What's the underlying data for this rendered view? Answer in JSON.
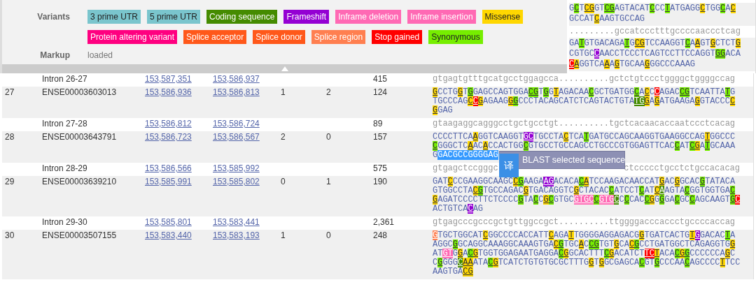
{
  "legend": {
    "variants_label": "Variants",
    "markup_label": "Markup",
    "markup_value": "loaded",
    "variants": [
      {
        "label": "3 prime UTR",
        "kind": "three_prime_utr",
        "color": "#7ac5cd"
      },
      {
        "label": "5 prime UTR",
        "kind": "five_prime_utr",
        "color": "#7ac5cd"
      },
      {
        "label": "Coding sequence",
        "kind": "coding_sequence",
        "color": "#458b00"
      },
      {
        "label": "Frameshift",
        "kind": "frameshift",
        "color": "#9400d3"
      },
      {
        "label": "Inframe deletion",
        "kind": "inframe_deletion",
        "color": "#ff69b4"
      },
      {
        "label": "Inframe insertion",
        "kind": "inframe_insertion",
        "color": "#ff69b4"
      },
      {
        "label": "Missense",
        "kind": "missense",
        "color": "#ffd700"
      },
      {
        "label": "Protein altering variant",
        "kind": "protein_altering",
        "color": "#ff0080"
      },
      {
        "label": "Splice acceptor",
        "kind": "splice_acceptor",
        "color": "#ff581a"
      },
      {
        "label": "Splice donor",
        "kind": "splice_donor",
        "color": "#ff581a"
      },
      {
        "label": "Splice region",
        "kind": "splice_region",
        "color": "#ff7f50"
      },
      {
        "label": "Stop gained",
        "kind": "stop_gained",
        "color": "#ff0000"
      },
      {
        "label": "Synonymous",
        "kind": "synonymous",
        "color": "#76ee00"
      }
    ]
  },
  "upper_rows": [
    {
      "kind": "exon",
      "lines": [
        [
          {
            "text": "G"
          },
          {
            "text": "C",
            "kind": "synonymous"
          },
          {
            "text": "T"
          },
          {
            "text": "CG",
            "kind": "missense"
          },
          {
            "text": "GT"
          },
          {
            "text": "CG",
            "kind": "synonymous"
          },
          {
            "text": "AGTACAT"
          },
          {
            "text": "C",
            "kind": "synonymous"
          },
          {
            "text": "CC"
          },
          {
            "text": "T",
            "kind": "synonymous"
          },
          {
            "text": "ATGAGG"
          },
          {
            "text": "C",
            "kind": "missense"
          },
          {
            "text": "TGG"
          },
          {
            "text": "C",
            "kind": "synonymous"
          },
          {
            "text": "A"
          },
          {
            "text": "C",
            "kind": "missense"
          }
        ],
        [
          {
            "text": "GCCAT"
          },
          {
            "text": "C",
            "kind": "missense"
          },
          {
            "text": "AAGTGCCAG"
          }
        ]
      ]
    },
    {
      "kind": "intron",
      "sequence_parts": [
        ".........gccatccctttgccccaaccctcag"
      ]
    },
    {
      "kind": "exon",
      "lines": [
        [
          {
            "text": "GA"
          },
          {
            "text": "T",
            "kind": "synonymous"
          },
          {
            "text": "GTGACAGA"
          },
          {
            "text": "T",
            "kind": "synonymous"
          },
          {
            "text": "G"
          },
          {
            "text": "CG",
            "kind": "missense"
          },
          {
            "text": "TCCAAGGT"
          },
          {
            "text": "C",
            "kind": "synonymous"
          },
          {
            "text": "A"
          },
          {
            "text": "A",
            "kind": "missense"
          },
          {
            "text": "GT"
          },
          {
            "text": "G",
            "kind": "missense"
          },
          {
            "text": "CTCT"
          },
          {
            "text": "G",
            "kind": "missense"
          }
        ],
        [
          {
            "text": "CGTGC"
          },
          {
            "text": "C",
            "kind": "frameshift"
          },
          {
            "text": "AACCTCCCTCAGTCCTTCCAGGT"
          },
          {
            "text": "GG",
            "kind": "synonymous"
          },
          {
            "text": "ACA"
          }
        ],
        [
          {
            "text": "C",
            "kind": "stop_gained"
          },
          {
            "text": "A",
            "kind": "missense"
          },
          {
            "text": "GGTCA"
          },
          {
            "text": "A",
            "kind": "missense"
          },
          {
            "text": "A"
          },
          {
            "text": "G",
            "kind": "missense"
          },
          {
            "text": "TGCAA"
          },
          {
            "text": "G",
            "kind": "missense"
          },
          {
            "text": "GGCCCAAAG"
          }
        ]
      ]
    }
  ],
  "rows": [
    {
      "kind": "intron",
      "name": "Intron 26-27",
      "start": "153,587,351",
      "end": "153,586,937",
      "length": "415",
      "sequence_parts": [
        "gtgagtgtttgcatgcctggagcca..........gctctgtccctggggctggggccag"
      ]
    },
    {
      "kind": "exon",
      "no": "27",
      "name": "ENSE00003603013",
      "start": "153,586,936",
      "end": "153,586,813",
      "start_phase": "1",
      "end_phase": "2",
      "length": "124",
      "lines": [
        [
          {
            "text": "G",
            "kind": "missense"
          },
          {
            "text": "CCTG"
          },
          {
            "text": "G",
            "kind": "missense"
          },
          {
            "text": "T"
          },
          {
            "text": "G",
            "kind": "synonymous"
          },
          {
            "text": "GAGCCAGTGGA"
          },
          {
            "text": "CG",
            "kind": "synonymous"
          },
          {
            "text": "T"
          },
          {
            "text": "G",
            "kind": "synonymous"
          },
          {
            "text": "G"
          },
          {
            "text": "T",
            "kind": "missense"
          },
          {
            "text": "AGACAA"
          },
          {
            "text": "C",
            "kind": "synonymous"
          },
          {
            "text": "GCTGATGG"
          },
          {
            "text": "C",
            "kind": "synonymous"
          },
          {
            "text": "A"
          },
          {
            "text": "C",
            "kind": "missense"
          },
          {
            "text": "C"
          },
          {
            "text": "C",
            "kind": "stop_gained"
          },
          {
            "text": "AGAC"
          },
          {
            "text": "CG",
            "kind": "synonymous"
          },
          {
            "text": "TCAATTA"
          },
          {
            "text": "T",
            "kind": "synonymous"
          },
          {
            "text": "G"
          }
        ],
        [
          {
            "text": "TGCCCAG"
          },
          {
            "text": "C",
            "kind": "missense"
          },
          {
            "text": "C",
            "kind": "stop_gained"
          },
          {
            "text": "G",
            "kind": "missense"
          },
          {
            "text": "AGAAG"
          },
          {
            "text": "G",
            "kind": "missense"
          },
          {
            "text": "G",
            "kind": "synonymous"
          },
          {
            "text": "CCCTACAGCATCTCAGTACTGTA"
          },
          {
            "text": "TG",
            "kind": "coding_sequence"
          },
          {
            "text": "G",
            "kind": "missense"
          },
          {
            "text": "A"
          },
          {
            "text": "G",
            "kind": "missense"
          },
          {
            "text": "ATGAAGA"
          },
          {
            "text": "G",
            "kind": "missense"
          },
          {
            "text": "GTACCC"
          },
          {
            "text": "C",
            "kind": "missense"
          }
        ],
        [
          {
            "text": "G",
            "kind": "missense"
          },
          {
            "text": "GAG"
          }
        ]
      ]
    },
    {
      "kind": "intron",
      "name": "Intron 27-28",
      "start": "153,586,812",
      "end": "153,586,724",
      "length": "89",
      "sequence_parts": [
        "gtaagaggcagggcctgctgcctgt..........tgctcacaacaccaatccctcacag"
      ]
    },
    {
      "kind": "exon",
      "no": "28",
      "name": "ENSE00003643791",
      "start": "153,586,723",
      "end": "153,586,567",
      "start_phase": "2",
      "end_phase": "0",
      "length": "157",
      "blast_tooltip": {
        "label": "BLAST selected sequence",
        "translate": "译"
      },
      "lines": [
        [
          {
            "text": "CCCCTTCA"
          },
          {
            "text": "A",
            "kind": "missense"
          },
          {
            "text": "GGTCAAGGT"
          },
          {
            "text": "GC",
            "kind": "frameshift"
          },
          {
            "text": "TGCCTA"
          },
          {
            "text": "C",
            "kind": "missense"
          },
          {
            "text": "TCA"
          },
          {
            "text": "T",
            "kind": "synonymous"
          },
          {
            "text": "GATGCCAGCAAGGTGAAGGCCAG"
          },
          {
            "text": "T",
            "kind": "missense"
          },
          {
            "text": "GGCCC"
          }
        ],
        [
          {
            "text": "C",
            "kind": "synonymous"
          },
          {
            "text": "GGGCTC"
          },
          {
            "text": "A",
            "kind": "missense"
          },
          {
            "text": "AC"
          },
          {
            "text": "A",
            "kind": "missense"
          },
          {
            "text": "CCACTGG"
          },
          {
            "text": "C",
            "kind": "synonymous"
          },
          {
            "text": "GTGCCTGCCAGCCTGCCCGTGGAGTTCAC"
          },
          {
            "text": "C",
            "kind": "synonymous"
          },
          {
            "text": "AT"
          },
          {
            "text": "C",
            "kind": "synonymous"
          },
          {
            "text": "G",
            "kind": "missense"
          },
          {
            "text": "A"
          },
          {
            "text": "T",
            "kind": "synonymous"
          },
          {
            "text": "GCAAA"
          }
        ],
        [
          {
            "text": "G",
            "selected": false
          },
          {
            "text": "GACGCCGGGGAG",
            "selected": true
          }
        ]
      ]
    },
    {
      "kind": "intron",
      "name": "Intron 28-29",
      "start": "153,586,566",
      "end": "153,585,992",
      "length": "575",
      "sequence_parts": [
        "gtgagctccgggc",
        "ctccccctgcctctgccacacag"
      ]
    },
    {
      "kind": "exon",
      "no": "29",
      "name": "ENSE00003639210",
      "start": "153,585,991",
      "end": "153,585,802",
      "start_phase": "0",
      "end_phase": "1",
      "length": "190",
      "lines": [
        [
          {
            "text": "GAT"
          },
          {
            "text": "C",
            "kind": "missense"
          },
          {
            "text": "CCGAAGGCAAGC"
          },
          {
            "text": "C",
            "kind": "missense"
          },
          {
            "text": "G",
            "kind": "synonymous"
          },
          {
            "text": "AAGA"
          },
          {
            "text": "AG",
            "kind": "frameshift"
          },
          {
            "text": "ACACA"
          },
          {
            "text": "C",
            "kind": "synonymous"
          },
          {
            "text": "A",
            "kind": "missense"
          },
          {
            "text": "TCCAAGACAACCAT"
          },
          {
            "text": "G",
            "kind": "missense"
          },
          {
            "text": "AC"
          },
          {
            "text": "G",
            "kind": "missense"
          },
          {
            "text": "GCAC"
          },
          {
            "text": "G",
            "kind": "synonymous"
          },
          {
            "text": "TATACA"
          }
        ],
        [
          {
            "text": "GTGGCCTA"
          },
          {
            "text": "C",
            "kind": "missense"
          },
          {
            "text": "G",
            "kind": "synonymous"
          },
          {
            "text": "TGCCAGAC"
          },
          {
            "text": "G",
            "kind": "missense"
          },
          {
            "text": "TGACAGGTC"
          },
          {
            "text": "G",
            "kind": "missense"
          },
          {
            "text": "CTACAC"
          },
          {
            "text": "C",
            "kind": "synonymous"
          },
          {
            "text": "ATCCT"
          },
          {
            "text": "C",
            "kind": "synonymous"
          },
          {
            "text": "AT"
          },
          {
            "text": "C",
            "kind": "missense"
          },
          {
            "text": "A",
            "kind": "coding_sequence"
          },
          {
            "text": "AGTA"
          },
          {
            "text": "C",
            "kind": "synonymous"
          },
          {
            "text": "GGTGGTGA"
          },
          {
            "text": "C",
            "kind": "synonymous"
          }
        ],
        [
          {
            "text": "G",
            "kind": "missense"
          },
          {
            "text": "AGATCCCCTTCTCCCC"
          },
          {
            "text": "G",
            "kind": "synonymous"
          },
          {
            "text": "TA"
          },
          {
            "text": "C",
            "kind": "synonymous"
          },
          {
            "text": "C"
          },
          {
            "text": "G",
            "kind": "missense"
          },
          {
            "text": "C",
            "kind": "synonymous"
          },
          {
            "text": "GTGC"
          },
          {
            "text": "GTGC",
            "kind": "inframe_deletion"
          },
          {
            "text": "C",
            "kind": "synonymous"
          },
          {
            "text": "GTG",
            "kind": "inframe_deletion"
          },
          {
            "text": "C",
            "kind": "coding_sequence"
          },
          {
            "text": "C"
          },
          {
            "text": "C",
            "kind": "synonymous"
          },
          {
            "text": "CAC"
          },
          {
            "text": "C",
            "kind": "synonymous"
          },
          {
            "text": "G",
            "kind": "missense"
          },
          {
            "text": "G"
          },
          {
            "text": "G",
            "kind": "synonymous"
          },
          {
            "text": "GA"
          },
          {
            "text": "C",
            "kind": "synonymous"
          },
          {
            "text": "GC"
          },
          {
            "text": "C",
            "kind": "synonymous"
          },
          {
            "text": "AGCAAGT"
          },
          {
            "text": "G",
            "kind": "synonymous"
          },
          {
            "text": "C",
            "kind": "stop_gained"
          }
        ],
        [
          {
            "text": "ACTGTCA"
          },
          {
            "text": "C",
            "kind": "frameshift"
          },
          {
            "text": "AG"
          }
        ]
      ]
    },
    {
      "kind": "intron",
      "name": "Intron 29-30",
      "start": "153,585,801",
      "end": "153,583,441",
      "length": "2,361",
      "sequence_parts": [
        "gtgagcccgcccgctgttggccgct..........ttggggacccaccctgccccaccag"
      ]
    },
    {
      "kind": "exon",
      "no": "30",
      "name": "ENSE00003507155",
      "start": "153,583,440",
      "end": "153,583,193",
      "start_phase": "1",
      "end_phase": "0",
      "length": "248",
      "lines": [
        [
          {
            "text": "G",
            "kind": "splice_region"
          },
          {
            "text": "TGCTGGCAT"
          },
          {
            "text": "C",
            "kind": "missense"
          },
          {
            "text": "GGCCCCACCATT"
          },
          {
            "text": "C",
            "kind": "missense"
          },
          {
            "text": "AGA"
          },
          {
            "text": "T",
            "kind": "missense"
          },
          {
            "text": "TGGGGAGGAGACG"
          },
          {
            "text": "G",
            "kind": "missense"
          },
          {
            "text": "TGATCACTG"
          },
          {
            "text": "T",
            "kind": "missense"
          },
          {
            "text": "G",
            "kind": "frameshift"
          },
          {
            "text": "GACAC"
          },
          {
            "text": "T",
            "kind": "synonymous"
          },
          {
            "text": "A"
          }
        ],
        [
          {
            "text": "AGGC"
          },
          {
            "text": "G",
            "kind": "synonymous"
          },
          {
            "text": "GCAGGCAAAGGCAAAGTGA"
          },
          {
            "text": "C",
            "kind": "missense"
          },
          {
            "text": "G",
            "kind": "synonymous"
          },
          {
            "text": "TGC"
          },
          {
            "text": "A",
            "kind": "missense"
          },
          {
            "text": "C"
          },
          {
            "text": "CG",
            "kind": "synonymous"
          },
          {
            "text": "TGT"
          },
          {
            "text": "G",
            "kind": "missense"
          },
          {
            "text": "CA"
          },
          {
            "text": "C",
            "kind": "missense"
          },
          {
            "text": "G",
            "kind": "synonymous"
          },
          {
            "text": "CCTGATGGCTCAGAGGTG"
          },
          {
            "text": "G",
            "kind": "missense"
          }
        ],
        [
          {
            "text": "AT"
          },
          {
            "text": "GT",
            "kind": "inframe_deletion"
          },
          {
            "text": "G"
          },
          {
            "text": "G",
            "kind": "missense"
          },
          {
            "text": "A"
          },
          {
            "text": "C",
            "kind": "synonymous"
          },
          {
            "text": "G",
            "kind": "missense"
          },
          {
            "text": "TGGTGGAGAATGAGGA"
          },
          {
            "text": "C",
            "kind": "synonymous"
          },
          {
            "text": "G",
            "kind": "missense"
          },
          {
            "text": "GCACTTT"
          },
          {
            "text": "C",
            "kind": "synonymous"
          },
          {
            "text": "G",
            "kind": "missense"
          },
          {
            "text": "ACATCT"
          },
          {
            "text": "TC",
            "kind": "stop_gained"
          },
          {
            "text": "T",
            "kind": "missense"
          },
          {
            "text": "ACA"
          },
          {
            "text": "C",
            "kind": "synonymous"
          },
          {
            "text": "G",
            "kind": "missense"
          },
          {
            "text": "G",
            "kind": "synonymous"
          },
          {
            "text": "CCCCCCA"
          },
          {
            "text": "G",
            "kind": "missense"
          },
          {
            "text": "C"
          }
        ],
        [
          {
            "text": "C"
          },
          {
            "text": "G",
            "kind": "synonymous"
          },
          {
            "text": "GGG"
          },
          {
            "text": "C",
            "kind": "coding_sequence"
          },
          {
            "text": "AA",
            "kind": "missense"
          },
          {
            "text": "ATA"
          },
          {
            "text": "C",
            "kind": "synonymous"
          },
          {
            "text": "G",
            "kind": "missense"
          },
          {
            "text": "TCATCTGTGTGCGCTTTG"
          },
          {
            "text": "G",
            "kind": "missense"
          },
          {
            "text": "T"
          },
          {
            "text": "G",
            "kind": "missense"
          },
          {
            "text": "GCGAGCA"
          },
          {
            "text": "C",
            "kind": "synonymous"
          },
          {
            "text": "GT"
          },
          {
            "text": "G",
            "kind": "synonymous"
          },
          {
            "text": "CCCAA"
          },
          {
            "text": "C",
            "kind": "synonymous"
          },
          {
            "text": "AGCCCC"
          },
          {
            "text": "T",
            "kind": "missense"
          },
          {
            "text": "TCC"
          }
        ],
        [
          {
            "text": "AAGTGA"
          },
          {
            "text": "CG",
            "kind": "missense"
          }
        ]
      ]
    }
  ]
}
